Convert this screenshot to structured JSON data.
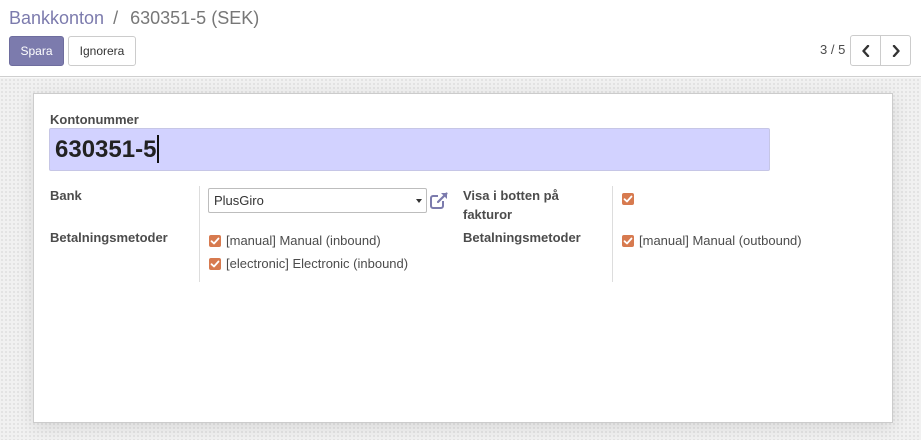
{
  "breadcrumb": {
    "parent": "Bankkonton",
    "separator": "/",
    "current": "630351-5 (SEK)"
  },
  "toolbar": {
    "save_label": "Spara",
    "discard_label": "Ignorera"
  },
  "pager": {
    "value": "3 / 5"
  },
  "form": {
    "account_number_label": "Kontonummer",
    "account_number_value": "630351-5",
    "bank_label": "Bank",
    "bank_value": "PlusGiro",
    "show_on_invoice_label": "Visa i botten på fakturor",
    "show_on_invoice_checked": true,
    "inbound_methods_label": "Betalningsmetoder",
    "inbound_methods": [
      {
        "label": "[manual] Manual (inbound)",
        "checked": true
      },
      {
        "label": "[electronic] Electronic (inbound)",
        "checked": true
      }
    ],
    "outbound_methods_label": "Betalningsmetoder",
    "outbound_methods": [
      {
        "label": "[manual] Manual (outbound)",
        "checked": true
      }
    ]
  },
  "icons": {
    "pager_prev": "chevron-left-icon",
    "pager_next": "chevron-right-icon",
    "external_link": "external-link-icon",
    "dropdown": "caret-down-icon",
    "checkbox": "checkmark-icon"
  },
  "colors": {
    "brand": "#7c7bad",
    "checkbox": "#d77a4f",
    "title_input_bg": "#d2d2ff"
  }
}
